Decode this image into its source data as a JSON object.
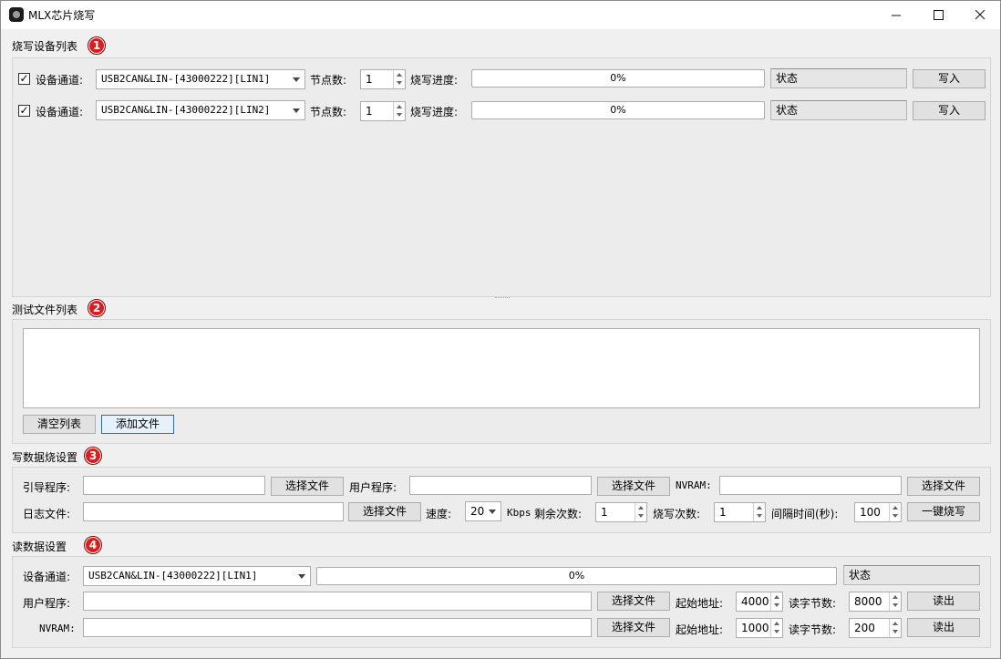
{
  "window": {
    "title": "MLX芯片烧写"
  },
  "section1": {
    "title": "烧写设备列表",
    "badge": "1",
    "rows": [
      {
        "checked": "✓",
        "channel_label": "设备通道:",
        "channel_value": "USB2CAN&LIN-[43000222][LIN1]",
        "nodes_label": "节点数:",
        "nodes_value": "1",
        "progress_label": "烧写进度:",
        "progress_text": "0%",
        "progress": 0,
        "status": "状态",
        "write_button": "写入"
      },
      {
        "checked": "✓",
        "channel_label": "设备通道:",
        "channel_value": "USB2CAN&LIN-[43000222][LIN2]",
        "nodes_label": "节点数:",
        "nodes_value": "1",
        "progress_label": "烧写进度:",
        "progress_text": "0%",
        "progress": 0,
        "status": "状态",
        "write_button": "写入"
      }
    ]
  },
  "section2": {
    "title": "测试文件列表",
    "badge": "2",
    "clear_button": "清空列表",
    "add_button": "添加文件"
  },
  "section3": {
    "title": "写数据烧设置",
    "badge": "3",
    "boot_label": "引导程序:",
    "boot_button": "选择文件",
    "user_label": "用户程序:",
    "user_button": "选择文件",
    "nvram_label": "NVRAM:",
    "nvram_button": "选择文件",
    "log_label": "日志文件:",
    "log_button": "选择文件",
    "speed_label": "速度:",
    "speed_value": "20",
    "speed_unit": "Kbps",
    "remaining_label": "剩余次数:",
    "remaining_value": "1",
    "burn_count_label": "烧写次数:",
    "burn_count_value": "1",
    "interval_label": "间隔时间(秒):",
    "interval_value": "100",
    "one_click_button": "一键烧写"
  },
  "section4": {
    "title": "读数据设置",
    "badge": "4",
    "channel_label": "设备通道:",
    "channel_value": "USB2CAN&LIN-[43000222][LIN1]",
    "progress_text": "0%",
    "progress": 0,
    "status": "状态",
    "user_label": "用户程序:",
    "user_button": "选择文件",
    "user_addr_label": "起始地址:",
    "user_addr_value": "4000",
    "user_bytes_label": "读字节数:",
    "user_bytes_value": "8000",
    "user_read_button": "读出",
    "nvram_label": "NVRAM:",
    "nvram_button": "选择文件",
    "nvram_addr_label": "起始地址:",
    "nvram_addr_value": "1000",
    "nvram_bytes_label": "读字节数:",
    "nvram_bytes_value": "200",
    "nvram_read_button": "读出"
  },
  "icons": {
    "minimize": "minimize-icon",
    "maximize": "maximize-icon",
    "close": "close-icon"
  }
}
